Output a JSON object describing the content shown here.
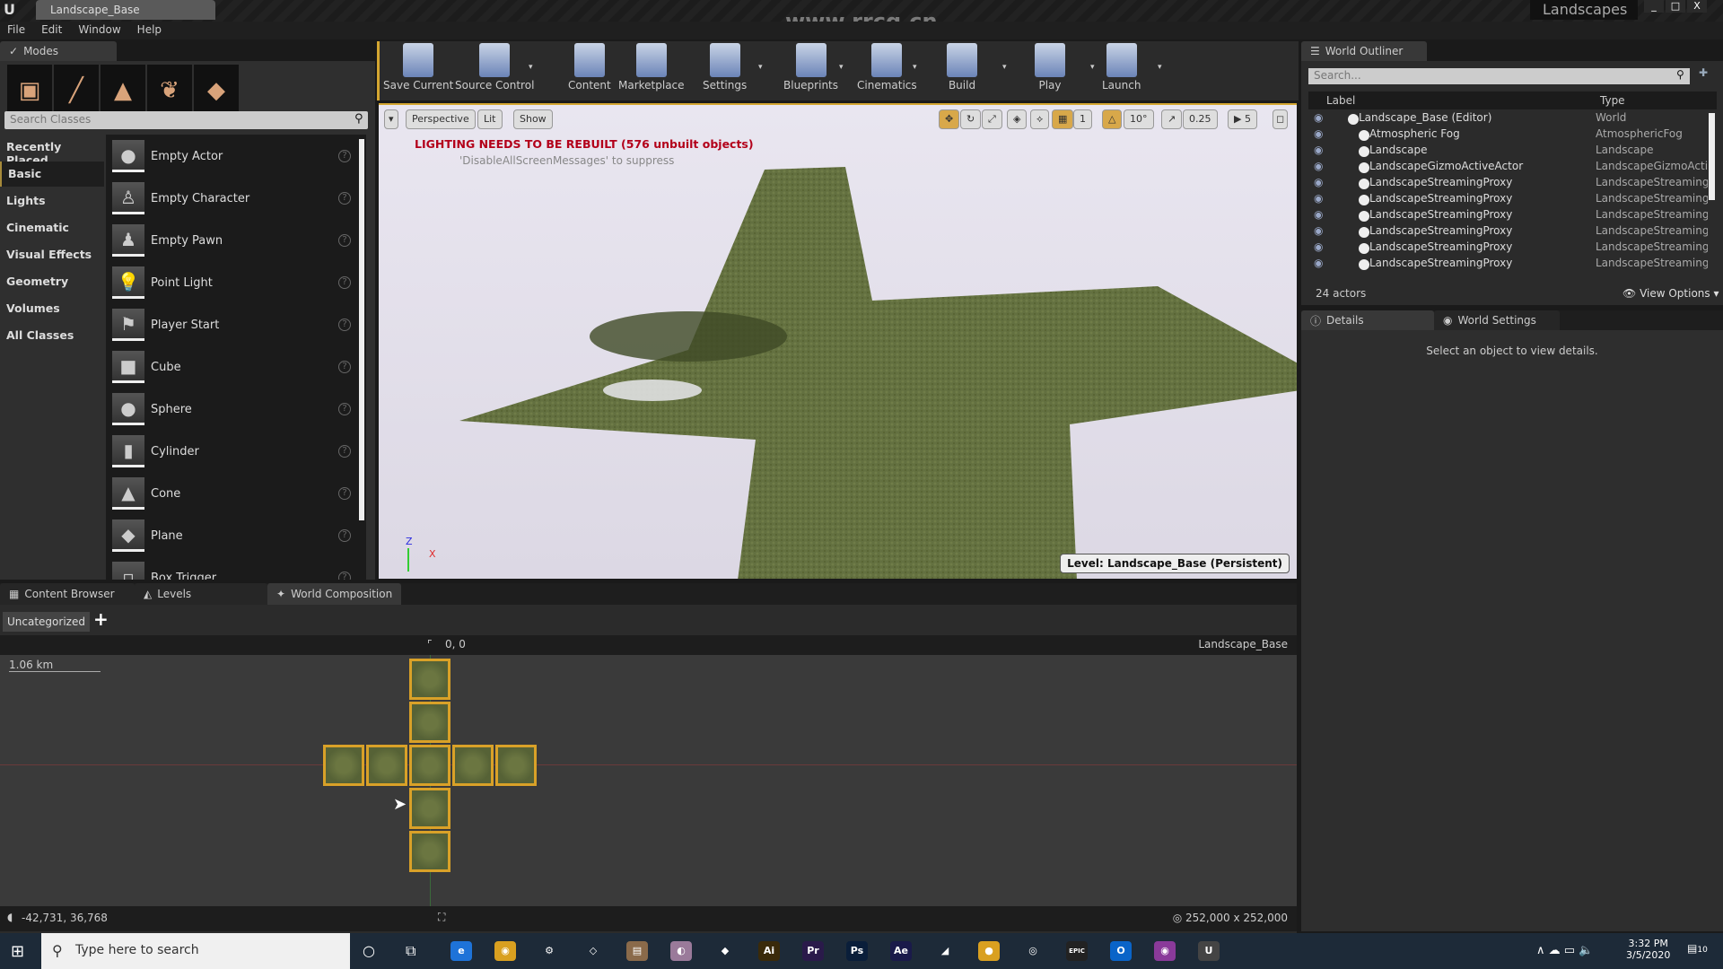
{
  "window": {
    "title": "Landscape_Base",
    "project": "Landscapes",
    "watermark": "www.rrcg.cn",
    "controls": [
      "_",
      "□",
      "X"
    ]
  },
  "menu": [
    "File",
    "Edit",
    "Window",
    "Help"
  ],
  "modes": {
    "tab": "Modes",
    "search_placeholder": "Search Classes",
    "categories": [
      "Recently Placed",
      "Basic",
      "Lights",
      "Cinematic",
      "Visual Effects",
      "Geometry",
      "Volumes",
      "All Classes"
    ],
    "selected_category": "Basic",
    "items": [
      {
        "label": "Empty Actor",
        "icon": "●"
      },
      {
        "label": "Empty Character",
        "icon": "♙"
      },
      {
        "label": "Empty Pawn",
        "icon": "♟"
      },
      {
        "label": "Point Light",
        "icon": "💡"
      },
      {
        "label": "Player Start",
        "icon": "⚑"
      },
      {
        "label": "Cube",
        "icon": "■"
      },
      {
        "label": "Sphere",
        "icon": "●"
      },
      {
        "label": "Cylinder",
        "icon": "▮"
      },
      {
        "label": "Cone",
        "icon": "▲"
      },
      {
        "label": "Plane",
        "icon": "◆"
      },
      {
        "label": "Box Trigger",
        "icon": "▫"
      }
    ]
  },
  "toolbar": [
    {
      "label": "Save Current",
      "caret": false
    },
    {
      "label": "Source Control",
      "caret": true
    },
    {
      "label": "Content",
      "caret": false
    },
    {
      "label": "Marketplace",
      "caret": false
    },
    {
      "label": "Settings",
      "caret": true
    },
    {
      "label": "Blueprints",
      "caret": true
    },
    {
      "label": "Cinematics",
      "caret": true
    },
    {
      "label": "Build",
      "caret": true
    },
    {
      "label": "Play",
      "caret": true
    },
    {
      "label": "Launch",
      "caret": true
    }
  ],
  "viewport": {
    "perspective": "Perspective",
    "lit": "Lit",
    "show": "Show",
    "grid_snap": "1",
    "rot_snap": "10°",
    "scale_snap": "0.25",
    "camera_speed": "5",
    "warning": "LIGHTING NEEDS TO BE REBUILT (576 unbuilt objects)",
    "suppress": "'DisableAllScreenMessages' to suppress",
    "level_prefix": "Level:",
    "level": "Landscape_Base (Persistent)",
    "axis_z": "Z",
    "axis_x": "X"
  },
  "outliner": {
    "tab": "World Outliner",
    "search_placeholder": "Search...",
    "col_label": "Label",
    "col_type": "Type",
    "rows": [
      {
        "label": "Landscape_Base (Editor)",
        "type": "World"
      },
      {
        "label": "Atmospheric Fog",
        "type": "AtmosphericFog"
      },
      {
        "label": "Landscape",
        "type": "Landscape"
      },
      {
        "label": "LandscapeGizmoActiveActor",
        "type": "LandscapeGizmoActiv"
      },
      {
        "label": "LandscapeStreamingProxy",
        "type": "LandscapeStreamingF"
      },
      {
        "label": "LandscapeStreamingProxy",
        "type": "LandscapeStreamingF"
      },
      {
        "label": "LandscapeStreamingProxy",
        "type": "LandscapeStreamingF"
      },
      {
        "label": "LandscapeStreamingProxy",
        "type": "LandscapeStreamingF"
      },
      {
        "label": "LandscapeStreamingProxy",
        "type": "LandscapeStreamingF"
      },
      {
        "label": "LandscapeStreamingProxy",
        "type": "LandscapeStreamingF"
      }
    ],
    "count": "24 actors",
    "view_options": "View Options"
  },
  "details": {
    "tab": "Details",
    "tab2": "World Settings",
    "empty": "Select an object to view details."
  },
  "bottom": {
    "tabs": [
      "Content Browser",
      "Levels",
      "World Composition"
    ],
    "category": "Uncategorized",
    "add": "+",
    "origin": "0, 0",
    "world": "Landscape_Base",
    "scale": "1.06 km",
    "cursor": "-42,731, 36,768",
    "size": "252,000 x 252,000"
  },
  "taskbar": {
    "search_placeholder": "Type here to search",
    "time": "3:32 PM",
    "date": "3/5/2020",
    "notifications": "10",
    "apps": [
      {
        "name": "edge",
        "txt": "e",
        "c": "#1e73d8"
      },
      {
        "name": "chrome",
        "txt": "◉",
        "c": "#d9a020"
      },
      {
        "name": "settings",
        "txt": "⚙",
        "c": "transparent"
      },
      {
        "name": "vscode",
        "txt": "◇",
        "c": "transparent"
      },
      {
        "name": "app",
        "txt": "▤",
        "c": "#8a6a4a"
      },
      {
        "name": "app",
        "txt": "◐",
        "c": "#9a7a9a"
      },
      {
        "name": "app",
        "txt": "◆",
        "c": "transparent"
      },
      {
        "name": "illustrator",
        "txt": "Ai",
        "c": "#3a2a0a"
      },
      {
        "name": "premiere",
        "txt": "Pr",
        "c": "#2a1a4a"
      },
      {
        "name": "photoshop",
        "txt": "Ps",
        "c": "#0a1e3a"
      },
      {
        "name": "after-effects",
        "txt": "Ae",
        "c": "#1a1a4a"
      },
      {
        "name": "app",
        "txt": "◢",
        "c": "transparent"
      },
      {
        "name": "app",
        "txt": "●",
        "c": "#d9a020"
      },
      {
        "name": "obs",
        "txt": "◎",
        "c": "transparent"
      },
      {
        "name": "epic",
        "txt": "EPIC",
        "c": "#222"
      },
      {
        "name": "outlook",
        "txt": "O",
        "c": "#0a64c8"
      },
      {
        "name": "app",
        "txt": "◉",
        "c": "#8a3a9a"
      },
      {
        "name": "unreal",
        "txt": "U",
        "c": "#444"
      }
    ]
  },
  "colors": {
    "accent": "#d4a631",
    "warning": "#b3001a",
    "tile_border": "#d9a128"
  }
}
